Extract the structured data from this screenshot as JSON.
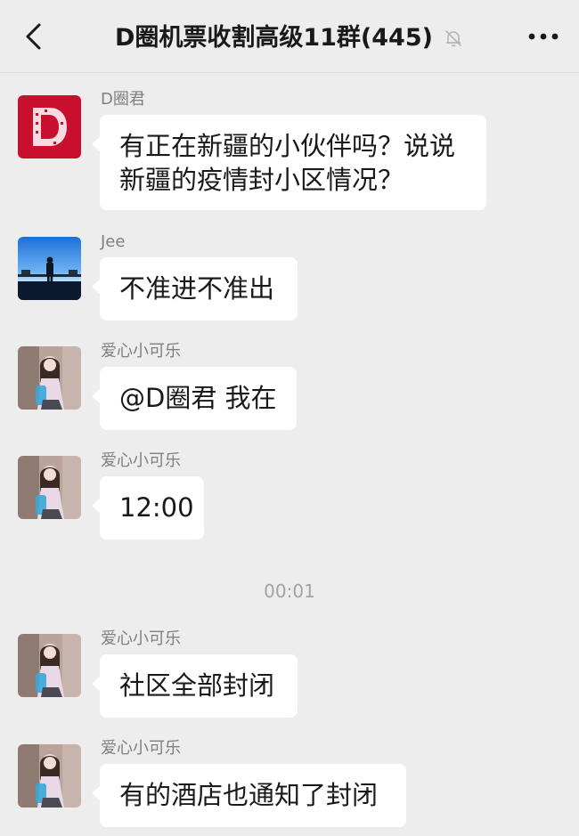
{
  "header": {
    "title": "D圈机票收割高级11群(445)",
    "back_icon": "chevron-left-icon",
    "mute_icon": "bell-off-icon",
    "more_icon": "more-dots-icon"
  },
  "messages": [
    {
      "sender": "D圈君",
      "text": "有正在新疆的小伙伴吗？说说新疆的疫情封小区情况？",
      "avatar": "brand-logo-red"
    },
    {
      "sender": "Jee",
      "text": "不准进不准出",
      "avatar": "silhouette-photo"
    },
    {
      "sender": "爱心小可乐",
      "text": "@D圈君 我在",
      "avatar": "girl-photo"
    },
    {
      "sender": "爱心小可乐",
      "text": "12:00",
      "avatar": "girl-photo"
    },
    {
      "sender": "爱心小可乐",
      "text": "社区全部封闭",
      "avatar": "girl-photo"
    },
    {
      "sender": "爱心小可乐",
      "text": "有的酒店也通知了封闭",
      "avatar": "girl-photo"
    }
  ],
  "timestamp": "00:01",
  "colors": {
    "background": "#ededed",
    "bubble": "#ffffff",
    "brand_red": "#c8102e"
  }
}
